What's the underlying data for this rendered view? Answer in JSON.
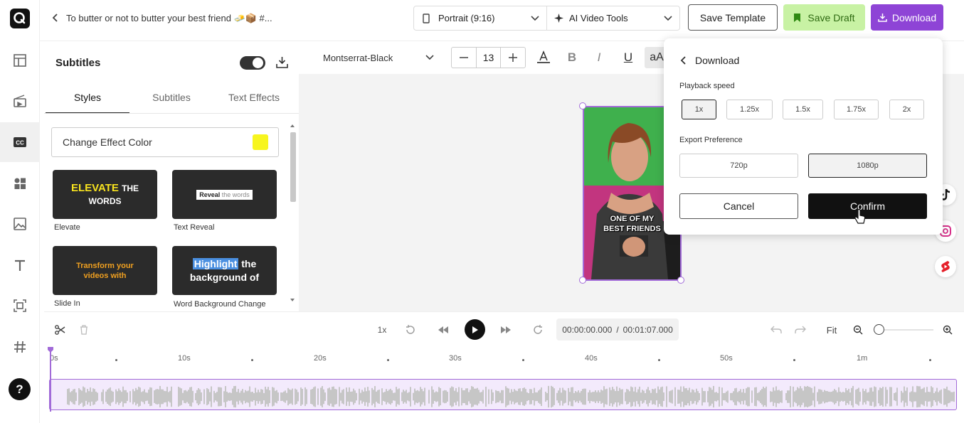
{
  "topbar": {
    "project_title": "To butter or not to butter your best friend 🧈📦 #...",
    "aspect_label": "Portrait (9:16)",
    "ai_tools_label": "AI Video Tools",
    "save_template_label": "Save Template",
    "save_draft_label": "Save Draft",
    "download_label": "Download"
  },
  "panel": {
    "title": "Subtitles",
    "tabs": [
      "Styles",
      "Subtitles",
      "Text Effects"
    ],
    "change_color_label": "Change Effect Color",
    "effect_color": "#f7f51f",
    "cards": [
      {
        "label": "Elevate",
        "preview_a": "ELEVATE",
        "preview_b": "THE",
        "preview_c": "WORDS"
      },
      {
        "label": "Text Reveal",
        "preview_a": "Reveal",
        "preview_b": "the words"
      },
      {
        "label": "Slide In",
        "preview_a": "Transform your",
        "preview_b": "videos with"
      },
      {
        "label": "Word Background Change",
        "preview_a": "Highlight",
        "preview_b": "the",
        "preview_c": "background of"
      }
    ]
  },
  "format_toolbar": {
    "font": "Montserrat-Black",
    "size": "13",
    "case_label": "aA"
  },
  "video": {
    "caption_line1": "ONE OF MY",
    "caption_line2": "BEST FRIENDS"
  },
  "download_popover": {
    "title": "Download",
    "playback_label": "Playback speed",
    "speeds": [
      "1x",
      "1.25x",
      "1.5x",
      "1.75x",
      "2x"
    ],
    "selected_speed": "1x",
    "export_label": "Export Preference",
    "resolutions": [
      "720p",
      "1080p"
    ],
    "selected_resolution": "1080p",
    "cancel_label": "Cancel",
    "confirm_label": "Confirm"
  },
  "timeline": {
    "speed": "1x",
    "current_time": "00:00:00.000",
    "total_time": "00:01:07.000",
    "fit_label": "Fit",
    "ruler": [
      "0s",
      "10s",
      "20s",
      "30s",
      "40s",
      "50s",
      "1m"
    ]
  },
  "colors": {
    "accent": "#a16ad8",
    "save_draft_bg": "#c8f2a4",
    "download_bg": "#8e44d6"
  }
}
